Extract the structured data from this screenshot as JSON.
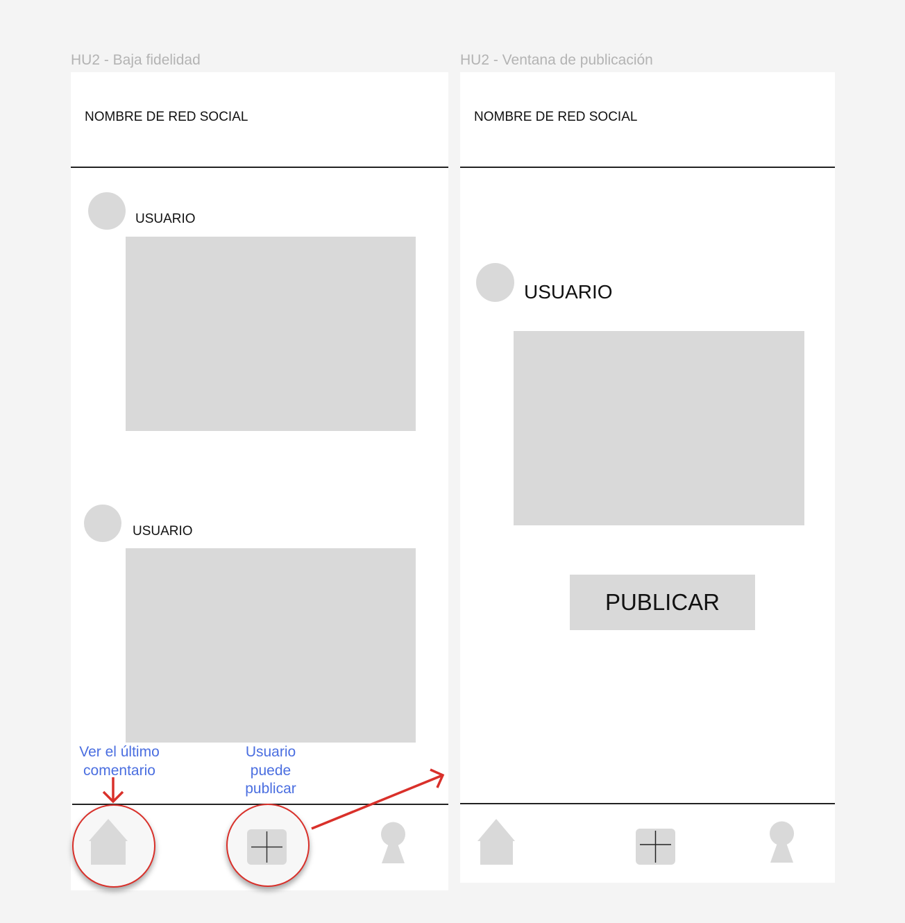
{
  "frames": [
    {
      "title": "HU2 - Baja fidelidad",
      "app_name": "NOMBRE DE RED SOCIAL",
      "posts": [
        {
          "user": "USUARIO"
        },
        {
          "user": "USUARIO"
        }
      ],
      "annotations": {
        "home": "Ver el último comentario",
        "add": "Usuario puede publicar"
      }
    },
    {
      "title": "HU2 - Ventana de publicación",
      "app_name": "NOMBRE DE RED SOCIAL",
      "post": {
        "user": "USUARIO"
      },
      "publish_label": "PUBLICAR"
    }
  ],
  "nav_icons": [
    "home-icon",
    "add-icon",
    "profile-icon"
  ],
  "colors": {
    "annotation": "#4a6ee0",
    "highlight": "#d9302a",
    "placeholder": "#d9d9d9"
  }
}
